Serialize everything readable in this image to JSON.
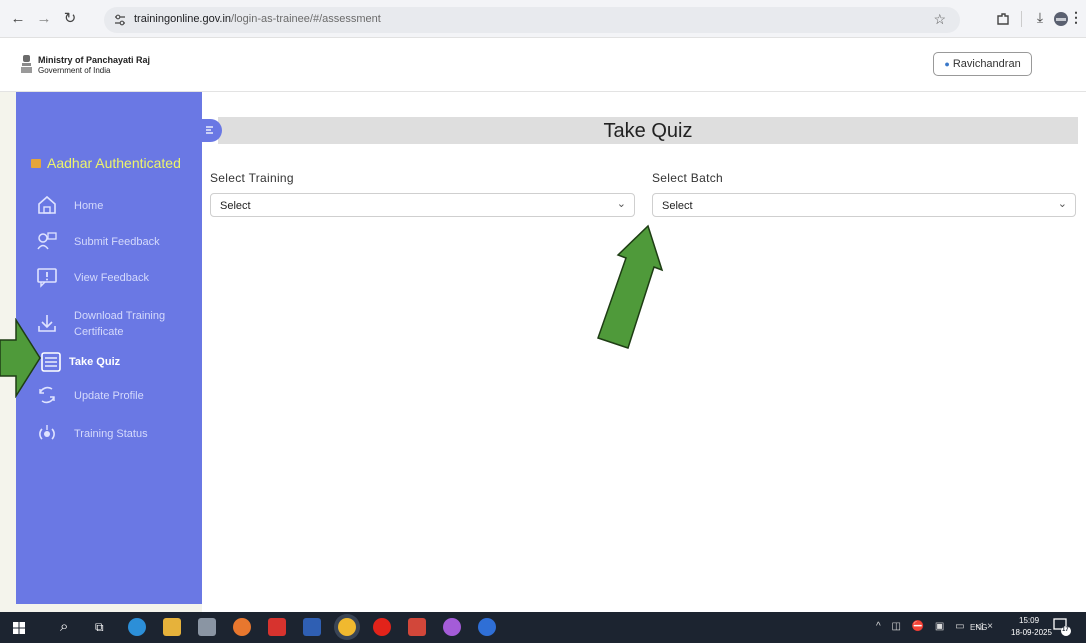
{
  "browser": {
    "url_host": "trainingonline.gov.in",
    "url_path": "/login-as-trainee/#/assessment",
    "icons": [
      "back-icon",
      "forward-icon",
      "reload-icon",
      "site-settings-icon",
      "star-icon",
      "extensions-icon",
      "download-icon",
      "profile-icon",
      "more-icon"
    ]
  },
  "header": {
    "org_title": "Ministry of Panchayati Raj",
    "org_subtitle": "Government of India",
    "user_name": "Ravichandran"
  },
  "sidebar": {
    "auth_status": "Aadhar Authenticated",
    "items": [
      {
        "label": "Home",
        "icon": "home-icon"
      },
      {
        "label": "Submit Feedback",
        "icon": "feedback-icon"
      },
      {
        "label": "View Feedback",
        "icon": "view-feedback-icon"
      },
      {
        "label": "Download Training Certificate",
        "icon": "download-icon"
      },
      {
        "label": "Take Quiz",
        "icon": "quiz-icon",
        "active": true
      },
      {
        "label": "Update Profile",
        "icon": "refresh-icon"
      },
      {
        "label": "Training Status",
        "icon": "status-icon"
      }
    ]
  },
  "main": {
    "title": "Take Quiz",
    "training_label": "Select Training",
    "training_value": "Select",
    "batch_label": "Select Batch",
    "batch_value": "Select"
  },
  "taskbar": {
    "lang": "ENG",
    "time": "15:09",
    "date": "18-09-2025",
    "notification_count": "17"
  },
  "colors": {
    "sidebar_bg": "#6a78e4",
    "auth_text": "#eef56a",
    "arrow_fill": "#4f9a3a",
    "taskbar_bg": "#1c2430"
  }
}
